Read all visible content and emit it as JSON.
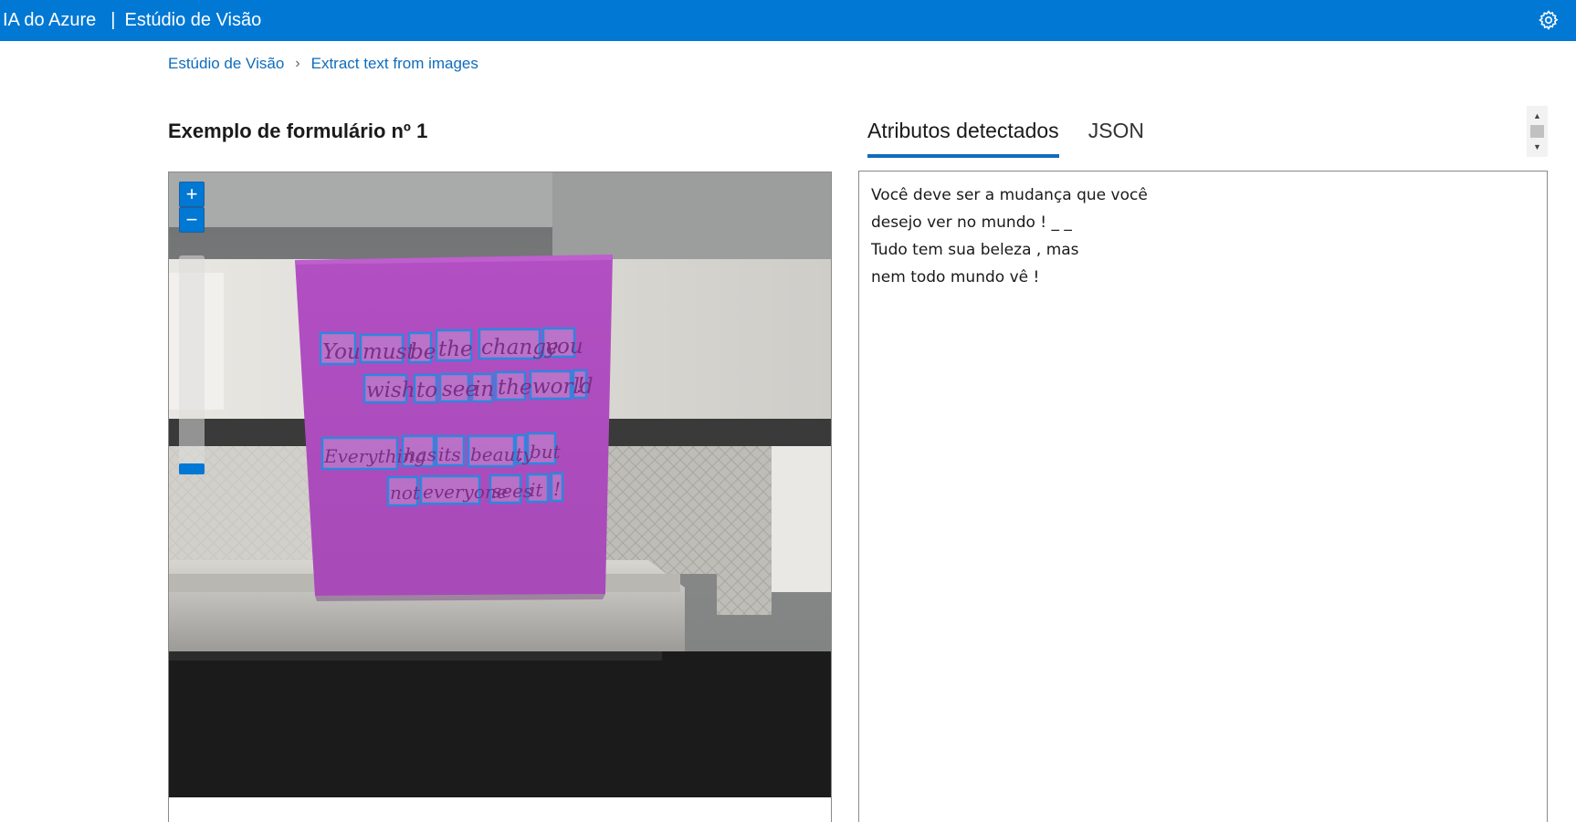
{
  "header": {
    "brand": "IA do Azure",
    "separator": "|",
    "product": "Estúdio de Visão",
    "settings_icon": "gear-icon"
  },
  "breadcrumb": {
    "items": [
      "Estúdio de Visão",
      "Extract text from images"
    ],
    "separator_icon": "chevron-right-icon"
  },
  "sample": {
    "title": "Exemplo de formulário nº 1",
    "zoom_in_label": "+",
    "zoom_out_label": "−",
    "zoom_level": 0.05,
    "handwriting": {
      "line1": [
        "You",
        "must",
        "be",
        "the",
        "change",
        "you"
      ],
      "line2": [
        "wish",
        "to",
        "see",
        "in",
        "the",
        "world",
        "!"
      ],
      "line3": [
        "Everything",
        "has",
        "its",
        "beauty",
        ",",
        "but"
      ],
      "line4": [
        "not",
        "everyone",
        "sees",
        "it",
        "!"
      ]
    }
  },
  "results": {
    "tabs": [
      {
        "label": "Atributos detectados",
        "active": true
      },
      {
        "label": "JSON",
        "active": false
      }
    ],
    "lines": [
      "Você deve ser a mudança que você",
      "desejo ver no mundo ! _ _",
      "Tudo tem sua beleza , mas",
      "nem todo mundo vê !"
    ]
  },
  "colors": {
    "brand_blue": "#0078d4",
    "link_blue": "#0f6cbd",
    "note_purple": "#b455c8",
    "box_blue": "#2e86de"
  }
}
